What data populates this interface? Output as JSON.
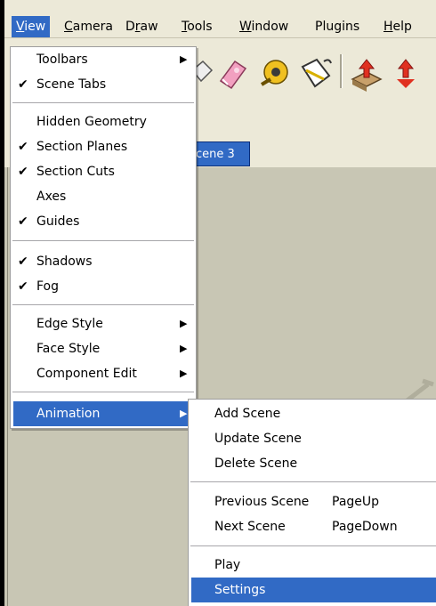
{
  "menubar": {
    "items": [
      "View",
      "Camera",
      "Draw",
      "Tools",
      "Window",
      "Plugins",
      "Help"
    ]
  },
  "scene_tab": {
    "label": "cene 3"
  },
  "view_menu": {
    "items": [
      {
        "label": "Toolbars",
        "checked": false,
        "submenu": true
      },
      {
        "label": "Scene Tabs",
        "checked": true,
        "submenu": false
      },
      {
        "label": "Hidden Geometry",
        "checked": false,
        "submenu": false
      },
      {
        "label": "Section Planes",
        "checked": true,
        "submenu": false
      },
      {
        "label": "Section Cuts",
        "checked": true,
        "submenu": false
      },
      {
        "label": "Axes",
        "checked": false,
        "submenu": false
      },
      {
        "label": "Guides",
        "checked": true,
        "submenu": false
      },
      {
        "label": "Shadows",
        "checked": true,
        "submenu": false
      },
      {
        "label": "Fog",
        "checked": true,
        "submenu": false
      },
      {
        "label": "Edge Style",
        "checked": false,
        "submenu": true
      },
      {
        "label": "Face Style",
        "checked": false,
        "submenu": true
      },
      {
        "label": "Component Edit",
        "checked": false,
        "submenu": true
      },
      {
        "label": "Animation",
        "checked": false,
        "submenu": true
      }
    ]
  },
  "animation_menu": {
    "items": [
      {
        "label": "Add Scene",
        "shortcut": ""
      },
      {
        "label": "Update Scene",
        "shortcut": ""
      },
      {
        "label": "Delete Scene",
        "shortcut": ""
      },
      {
        "label": "Previous Scene",
        "shortcut": "PageUp"
      },
      {
        "label": "Next Scene",
        "shortcut": "PageDown"
      },
      {
        "label": "Play",
        "shortcut": ""
      },
      {
        "label": "Settings",
        "shortcut": ""
      }
    ]
  },
  "icons": [
    "eraser-icon",
    "tape-measure-icon",
    "paint-bucket-icon",
    "push-pull-icon",
    "move-icon"
  ],
  "colors": {
    "highlight": "#316ac5",
    "chrome": "#ece9d8",
    "viewport": "#c8c6b4"
  }
}
